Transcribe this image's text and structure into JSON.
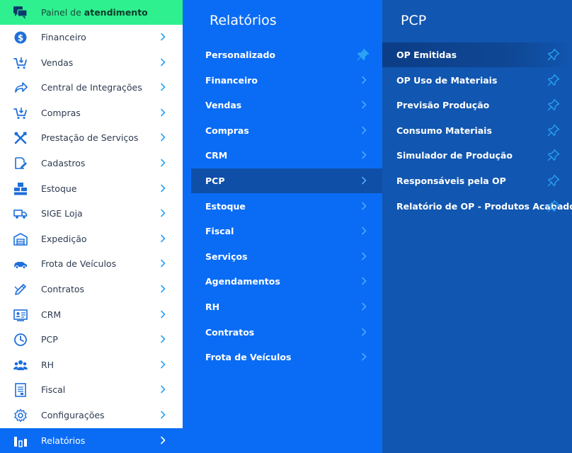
{
  "sidebar": {
    "header": {
      "label_prefix": "Painel de",
      "label_bold": "atendimento",
      "icon": "chat-icon"
    },
    "items": [
      {
        "label": "Financeiro",
        "icon": "dollar-icon"
      },
      {
        "label": "Vendas",
        "icon": "cart-icon"
      },
      {
        "label": "Central de Integrações",
        "icon": "share-icon"
      },
      {
        "label": "Compras",
        "icon": "cart-icon"
      },
      {
        "label": "Prestação de Serviços",
        "icon": "tools-icon"
      },
      {
        "label": "Cadastros",
        "icon": "edit-icon"
      },
      {
        "label": "Estoque",
        "icon": "boxes-icon"
      },
      {
        "label": "SIGE Loja",
        "icon": "truck-icon"
      },
      {
        "label": "Expedição",
        "icon": "warehouse-icon"
      },
      {
        "label": "Frota de Veículos",
        "icon": "car-icon"
      },
      {
        "label": "Contratos",
        "icon": "pen-icon"
      },
      {
        "label": "CRM",
        "icon": "contact-card-icon"
      },
      {
        "label": "PCP",
        "icon": "clock-icon"
      },
      {
        "label": "RH",
        "icon": "users-icon"
      },
      {
        "label": "Fiscal",
        "icon": "document-icon"
      },
      {
        "label": "Configurações",
        "icon": "gear-icon"
      },
      {
        "label": "Relatórios",
        "icon": "bar-chart-icon",
        "active": true
      }
    ]
  },
  "reports": {
    "title": "Relatórios",
    "items": [
      {
        "label": "Personalizado",
        "pinned": true
      },
      {
        "label": "Financeiro"
      },
      {
        "label": "Vendas"
      },
      {
        "label": "Compras"
      },
      {
        "label": "CRM"
      },
      {
        "label": "PCP",
        "active": true
      },
      {
        "label": "Estoque"
      },
      {
        "label": "Fiscal"
      },
      {
        "label": "Serviços"
      },
      {
        "label": "Agendamentos"
      },
      {
        "label": "RH"
      },
      {
        "label": "Contratos"
      },
      {
        "label": "Frota de Veículos"
      }
    ]
  },
  "pcp": {
    "title": "PCP",
    "items": [
      {
        "label": "OP Emitidas",
        "active": true
      },
      {
        "label": "OP Uso de Materiais"
      },
      {
        "label": "Previsão Produção"
      },
      {
        "label": "Consumo Materiais"
      },
      {
        "label": "Simulador de Produção"
      },
      {
        "label": "Responsáveis pela OP"
      },
      {
        "label": "Relatório de OP - Produtos Acabados"
      }
    ]
  },
  "colors": {
    "header_green": "#2ef08f",
    "active_blue": "#0a6cf5",
    "reports_bg": "#0a6cf5",
    "pcp_bg": "#1156b0",
    "icon_blue": "#1e6fd9",
    "chevron_blue": "#2aa3f5"
  }
}
